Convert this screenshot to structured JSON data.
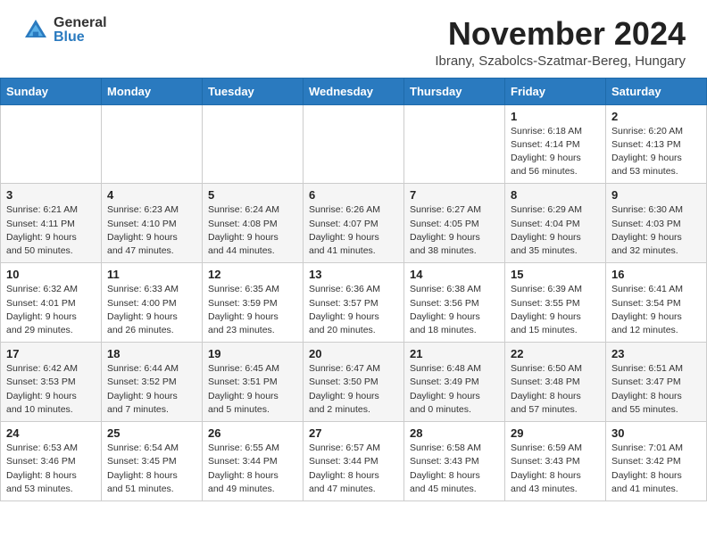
{
  "header": {
    "logo_general": "General",
    "logo_blue": "Blue",
    "month_title": "November 2024",
    "location": "Ibrany, Szabolcs-Szatmar-Bereg, Hungary"
  },
  "weekdays": [
    "Sunday",
    "Monday",
    "Tuesday",
    "Wednesday",
    "Thursday",
    "Friday",
    "Saturday"
  ],
  "weeks": [
    [
      {
        "day": "",
        "info": ""
      },
      {
        "day": "",
        "info": ""
      },
      {
        "day": "",
        "info": ""
      },
      {
        "day": "",
        "info": ""
      },
      {
        "day": "",
        "info": ""
      },
      {
        "day": "1",
        "info": "Sunrise: 6:18 AM\nSunset: 4:14 PM\nDaylight: 9 hours\nand 56 minutes."
      },
      {
        "day": "2",
        "info": "Sunrise: 6:20 AM\nSunset: 4:13 PM\nDaylight: 9 hours\nand 53 minutes."
      }
    ],
    [
      {
        "day": "3",
        "info": "Sunrise: 6:21 AM\nSunset: 4:11 PM\nDaylight: 9 hours\nand 50 minutes."
      },
      {
        "day": "4",
        "info": "Sunrise: 6:23 AM\nSunset: 4:10 PM\nDaylight: 9 hours\nand 47 minutes."
      },
      {
        "day": "5",
        "info": "Sunrise: 6:24 AM\nSunset: 4:08 PM\nDaylight: 9 hours\nand 44 minutes."
      },
      {
        "day": "6",
        "info": "Sunrise: 6:26 AM\nSunset: 4:07 PM\nDaylight: 9 hours\nand 41 minutes."
      },
      {
        "day": "7",
        "info": "Sunrise: 6:27 AM\nSunset: 4:05 PM\nDaylight: 9 hours\nand 38 minutes."
      },
      {
        "day": "8",
        "info": "Sunrise: 6:29 AM\nSunset: 4:04 PM\nDaylight: 9 hours\nand 35 minutes."
      },
      {
        "day": "9",
        "info": "Sunrise: 6:30 AM\nSunset: 4:03 PM\nDaylight: 9 hours\nand 32 minutes."
      }
    ],
    [
      {
        "day": "10",
        "info": "Sunrise: 6:32 AM\nSunset: 4:01 PM\nDaylight: 9 hours\nand 29 minutes."
      },
      {
        "day": "11",
        "info": "Sunrise: 6:33 AM\nSunset: 4:00 PM\nDaylight: 9 hours\nand 26 minutes."
      },
      {
        "day": "12",
        "info": "Sunrise: 6:35 AM\nSunset: 3:59 PM\nDaylight: 9 hours\nand 23 minutes."
      },
      {
        "day": "13",
        "info": "Sunrise: 6:36 AM\nSunset: 3:57 PM\nDaylight: 9 hours\nand 20 minutes."
      },
      {
        "day": "14",
        "info": "Sunrise: 6:38 AM\nSunset: 3:56 PM\nDaylight: 9 hours\nand 18 minutes."
      },
      {
        "day": "15",
        "info": "Sunrise: 6:39 AM\nSunset: 3:55 PM\nDaylight: 9 hours\nand 15 minutes."
      },
      {
        "day": "16",
        "info": "Sunrise: 6:41 AM\nSunset: 3:54 PM\nDaylight: 9 hours\nand 12 minutes."
      }
    ],
    [
      {
        "day": "17",
        "info": "Sunrise: 6:42 AM\nSunset: 3:53 PM\nDaylight: 9 hours\nand 10 minutes."
      },
      {
        "day": "18",
        "info": "Sunrise: 6:44 AM\nSunset: 3:52 PM\nDaylight: 9 hours\nand 7 minutes."
      },
      {
        "day": "19",
        "info": "Sunrise: 6:45 AM\nSunset: 3:51 PM\nDaylight: 9 hours\nand 5 minutes."
      },
      {
        "day": "20",
        "info": "Sunrise: 6:47 AM\nSunset: 3:50 PM\nDaylight: 9 hours\nand 2 minutes."
      },
      {
        "day": "21",
        "info": "Sunrise: 6:48 AM\nSunset: 3:49 PM\nDaylight: 9 hours\nand 0 minutes."
      },
      {
        "day": "22",
        "info": "Sunrise: 6:50 AM\nSunset: 3:48 PM\nDaylight: 8 hours\nand 57 minutes."
      },
      {
        "day": "23",
        "info": "Sunrise: 6:51 AM\nSunset: 3:47 PM\nDaylight: 8 hours\nand 55 minutes."
      }
    ],
    [
      {
        "day": "24",
        "info": "Sunrise: 6:53 AM\nSunset: 3:46 PM\nDaylight: 8 hours\nand 53 minutes."
      },
      {
        "day": "25",
        "info": "Sunrise: 6:54 AM\nSunset: 3:45 PM\nDaylight: 8 hours\nand 51 minutes."
      },
      {
        "day": "26",
        "info": "Sunrise: 6:55 AM\nSunset: 3:44 PM\nDaylight: 8 hours\nand 49 minutes."
      },
      {
        "day": "27",
        "info": "Sunrise: 6:57 AM\nSunset: 3:44 PM\nDaylight: 8 hours\nand 47 minutes."
      },
      {
        "day": "28",
        "info": "Sunrise: 6:58 AM\nSunset: 3:43 PM\nDaylight: 8 hours\nand 45 minutes."
      },
      {
        "day": "29",
        "info": "Sunrise: 6:59 AM\nSunset: 3:43 PM\nDaylight: 8 hours\nand 43 minutes."
      },
      {
        "day": "30",
        "info": "Sunrise: 7:01 AM\nSunset: 3:42 PM\nDaylight: 8 hours\nand 41 minutes."
      }
    ]
  ]
}
